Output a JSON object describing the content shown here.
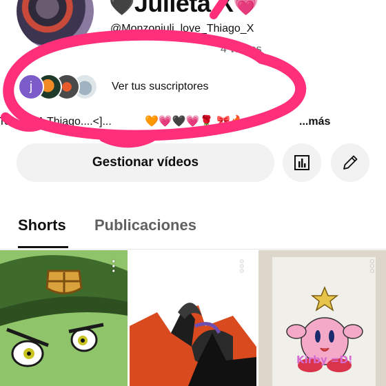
{
  "channel": {
    "name_prefix": "🖤",
    "name": "Julieta X",
    "name_suffix": "💗",
    "handle": "@Monzonjuli_love_Thiago_X",
    "video_count": "4 videos"
  },
  "subscribers": {
    "first_avatar_letter": "j",
    "link_label": "Ver tus suscriptores"
  },
  "description": {
    "text": "Te amo A Thiago....<]...",
    "emojis": "🧡💗🖤💗🌹 🎀🔥",
    "more_label": "...más"
  },
  "actions": {
    "manage_videos_label": "Gestionar vídeos",
    "stats_icon": "bar-chart-icon",
    "edit_icon": "pencil-icon"
  },
  "tabs": [
    {
      "label": "Shorts",
      "selected": true
    },
    {
      "label": "Publicaciones",
      "selected": false
    }
  ],
  "shorts": [
    {
      "icon": "more-vert-icon"
    },
    {
      "icon": "more-vert-icon"
    },
    {
      "icon": "more-vert-icon",
      "caption": "Kirby =D!"
    }
  ],
  "colors": {
    "scribble": "#ff2f7a",
    "chip_bg": "#f2f2f2",
    "text_primary": "#0f0f0f",
    "text_secondary": "#606060"
  }
}
